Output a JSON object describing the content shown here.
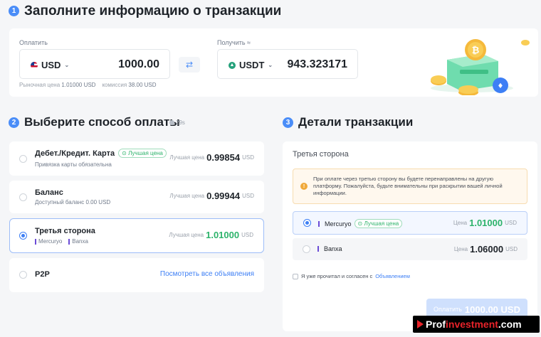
{
  "step1": {
    "num": "1",
    "title": "Заполните информацию о транзакции"
  },
  "pay": {
    "label": "Оплатить",
    "currency": "USD",
    "amount": "1000.00",
    "market_label": "Рыночная цена",
    "market_value": "1.01000 USD",
    "fee_label": "комиссия",
    "fee_value": "38.00 USD"
  },
  "receive": {
    "label": "Получить ≈",
    "currency": "USDT",
    "amount": "943.323171"
  },
  "step2": {
    "num": "2",
    "title": "Выберите способ оплаты",
    "timer": "29s"
  },
  "methods": [
    {
      "title": "Дебет./Кредит. Карта",
      "badge": "Лучшая цена",
      "sub": "Привязка карты обязательна",
      "price_label": "Лучшая цена",
      "price": "0.99854",
      "unit": "USD"
    },
    {
      "title": "Баланс",
      "sub": "Доступный баланс 0.00 USD",
      "price_label": "Лучшая цена",
      "price": "0.99944",
      "unit": "USD"
    },
    {
      "title": "Третья сторона",
      "sub1": "Mercuryo",
      "sub2": "Banxa",
      "price_label": "Лучшая цена",
      "price": "1.01000",
      "unit": "USD"
    },
    {
      "title": "P2P",
      "link": "Посмотреть все объявления"
    }
  ],
  "step3": {
    "num": "3",
    "title": "Детали транзакции"
  },
  "details": {
    "section": "Третья сторона",
    "notice": "При оплате через третью сторону вы будете перенаправлены на другую платформу. Пожалуйста, будьте внимательны при раскрытии вашей личной информации.",
    "providers": [
      {
        "name": "Mercuryo",
        "badge": "Лучшая цена",
        "price_label": "Цена",
        "price": "1.01000",
        "unit": "USD"
      },
      {
        "name": "Banxa",
        "price_label": "Цена",
        "price": "1.06000",
        "unit": "USD"
      }
    ],
    "agree_text": "Я уже прочитал и согласен с",
    "agree_link": "Объявлением",
    "pay_button_label": "Оплатить",
    "pay_button_amount": "1000.00 USD"
  },
  "watermark": {
    "part1": "Prof",
    "part2": "investment",
    "part3": ".com"
  },
  "colors": {
    "accent": "#3d7ff5",
    "green": "#2db36b",
    "warning_bg": "#fff8ee",
    "button_disabled": "#cfe0fd"
  }
}
